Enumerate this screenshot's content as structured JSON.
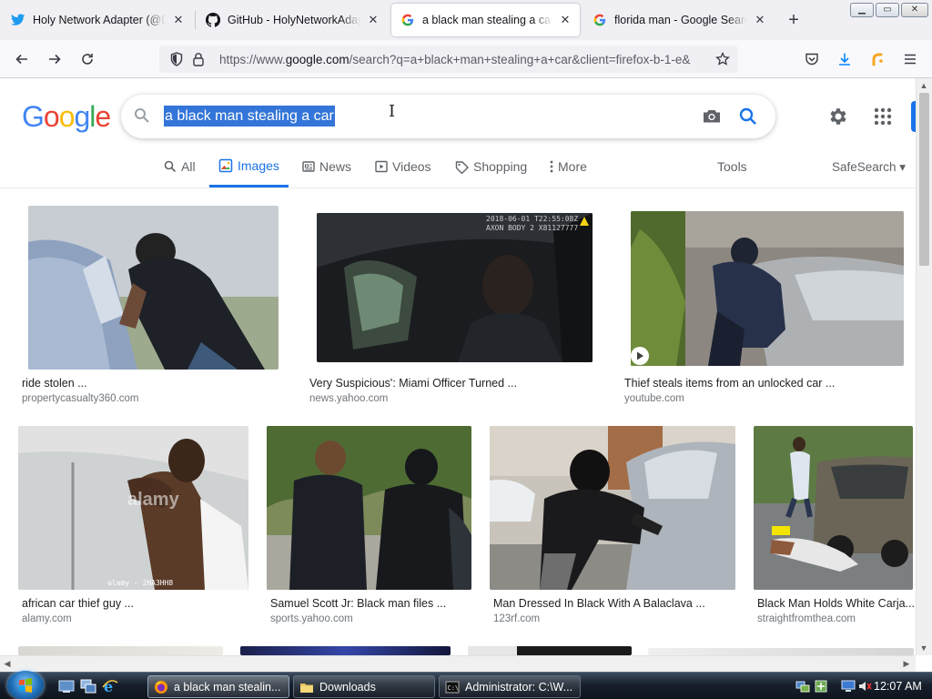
{
  "browser": {
    "tabs": [
      {
        "title": "Holy Network Adapter (@DES",
        "icon": "twitter-icon",
        "active": false
      },
      {
        "title": "GitHub - HolyNetworkAdapte",
        "icon": "github-icon",
        "active": false
      },
      {
        "title": "a black man stealing a car - G",
        "icon": "google-icon",
        "active": true
      },
      {
        "title": "florida man - Google Search",
        "icon": "google-icon",
        "active": false
      }
    ],
    "new_tab_label": "+",
    "url_prefix": "https://www.",
    "url_domain": "google.com",
    "url_rest": "/search?q=a+black+man+stealing+a+car&client=firefox-b-1-e&"
  },
  "google": {
    "logo_letters": [
      "G",
      "o",
      "o",
      "g",
      "l",
      "e"
    ],
    "logo_colors": [
      "#4285f4",
      "#ea4335",
      "#fbbc05",
      "#4285f4",
      "#34a853",
      "#ea4335"
    ],
    "query": "a black man stealing a car",
    "tabs": [
      {
        "label": "All",
        "icon": "search-icon",
        "active": false
      },
      {
        "label": "Images",
        "icon": "image-icon",
        "active": true
      },
      {
        "label": "News",
        "icon": "news-icon",
        "active": false
      },
      {
        "label": "Videos",
        "icon": "play-icon",
        "active": false
      },
      {
        "label": "Shopping",
        "icon": "tag-icon",
        "active": false
      },
      {
        "label": "More",
        "icon": "more-vert-icon",
        "active": false
      }
    ],
    "tools_label": "Tools",
    "safesearch_label": "SafeSearch ▾",
    "accent": "#1a73e8"
  },
  "results": [
    {
      "caption": "ride stolen ...",
      "source": "propertycasualty360.com"
    },
    {
      "caption": "Very Suspicious': Miami Officer Turned ...",
      "source": "news.yahoo.com",
      "watermark": "2018-06-01 T22:55:08Z\nAXON BODY 2 X81127777"
    },
    {
      "caption": "Thief steals items from an unlocked car ...",
      "source": "youtube.com"
    },
    {
      "caption": "african car thief guy ...",
      "source": "alamy.com",
      "watermark": "alamy - 2HA3HH8"
    },
    {
      "caption": "Samuel Scott Jr: Black man files ...",
      "source": "sports.yahoo.com"
    },
    {
      "caption": "Man Dressed In Black With A Balaclava ...",
      "source": "123rf.com"
    },
    {
      "caption": "Black Man Holds White Carja...",
      "source": "straightfromthea.com"
    }
  ],
  "taskbar": {
    "items": [
      {
        "label": "a black man stealin...",
        "icon": "firefox-icon",
        "active": true
      },
      {
        "label": "Downloads",
        "icon": "folder-icon",
        "active": false
      },
      {
        "label": "Administrator: C:\\W...",
        "icon": "cmd-icon",
        "active": false
      }
    ],
    "clock": "12:07 AM"
  }
}
